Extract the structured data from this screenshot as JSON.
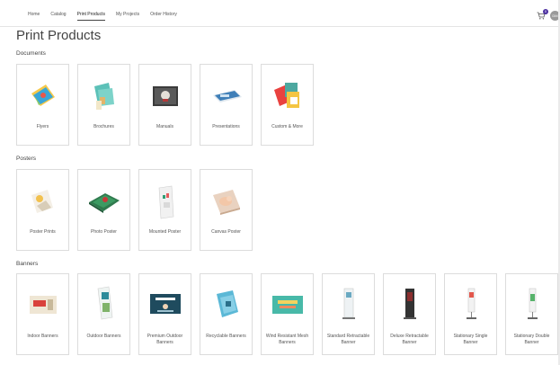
{
  "nav": {
    "items": [
      {
        "label": "Home"
      },
      {
        "label": "Catalog"
      },
      {
        "label": "Print Products"
      },
      {
        "label": "My Projects"
      },
      {
        "label": "Order History"
      }
    ],
    "active_index": 2,
    "cart_count": "0",
    "avatar_initials": "DM"
  },
  "page": {
    "title": "Print Products"
  },
  "sections": {
    "documents": {
      "label": "Documents",
      "items": [
        {
          "label": "Flyers",
          "icon": "flyers-image"
        },
        {
          "label": "Brochures",
          "icon": "brochures-image"
        },
        {
          "label": "Manuals",
          "icon": "manuals-image"
        },
        {
          "label": "Presentations",
          "icon": "presentations-image"
        },
        {
          "label": "Custom & More",
          "icon": "custom-more-image"
        }
      ]
    },
    "posters": {
      "label": "Posters",
      "items": [
        {
          "label": "Poster Prints",
          "icon": "poster-prints-image"
        },
        {
          "label": "Photo Poster",
          "icon": "photo-poster-image"
        },
        {
          "label": "Mounted Poster",
          "icon": "mounted-poster-image"
        },
        {
          "label": "Canvas Poster",
          "icon": "canvas-poster-image"
        }
      ]
    },
    "banners": {
      "label": "Banners",
      "items": [
        {
          "label": "Indoor Banners",
          "icon": "indoor-banners-image"
        },
        {
          "label": "Outdoor Banners",
          "icon": "outdoor-banners-image"
        },
        {
          "label": "Premium Outdoor Banners",
          "icon": "premium-outdoor-banners-image"
        },
        {
          "label": "Recyclable Banners",
          "icon": "recyclable-banners-image"
        },
        {
          "label": "Wind Resistant Mesh Banners",
          "icon": "mesh-banners-image"
        },
        {
          "label": "Standard Retractable Banner",
          "icon": "standard-retractable-image"
        },
        {
          "label": "Deluxe Retractable Banner",
          "icon": "deluxe-retractable-image"
        },
        {
          "label": "Stationary Single Banner",
          "icon": "stationary-single-image"
        },
        {
          "label": "Stationary Double Banner",
          "icon": "stationary-double-image"
        }
      ]
    }
  },
  "colors": {
    "accent": "#4b2fa0",
    "border": "#dcdcdc",
    "text": "#444444"
  }
}
